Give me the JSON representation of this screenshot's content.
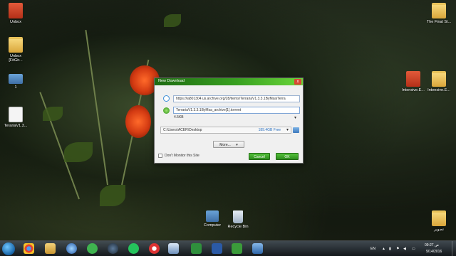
{
  "desktop": {
    "left_icons": [
      {
        "label": "Unbox"
      },
      {
        "label": "Unbox\n[FitGir..."
      },
      {
        "label": "1"
      },
      {
        "label": "TerariaV1.3..."
      }
    ],
    "right_icons": [
      {
        "label": "The Final St..."
      },
      {
        "label": "Intensive.E..."
      },
      {
        "label": "Intensive.E..."
      },
      {
        "label": "تصوير"
      }
    ],
    "bottom_icons": [
      {
        "label": "Computer"
      },
      {
        "label": "Recycle Bin"
      }
    ]
  },
  "dialog": {
    "title": "New Download",
    "close_label": "x",
    "url": "https://ia801304.us.archive.org/28/items/TerrariaV1.3.3.1ByMsa/Terra",
    "filename": "TerrariaV1.3.3.1ByMsa_archive[1].torrent",
    "size": "4.5KB",
    "save_path": "C:\\Users\\ACER\\Desktop",
    "free_space": "189.4GB Free",
    "more_label": "More...",
    "dont_monitor_label": "Don't Monitor this Site",
    "cancel_label": "Cancel",
    "ok_label": "OK"
  },
  "taskbar": {
    "language": "EN",
    "time": "09:27 ص",
    "date": "9/14/2016"
  },
  "colors": {
    "accent_green": "#38a020",
    "taskbar_dark": "#14181c"
  }
}
